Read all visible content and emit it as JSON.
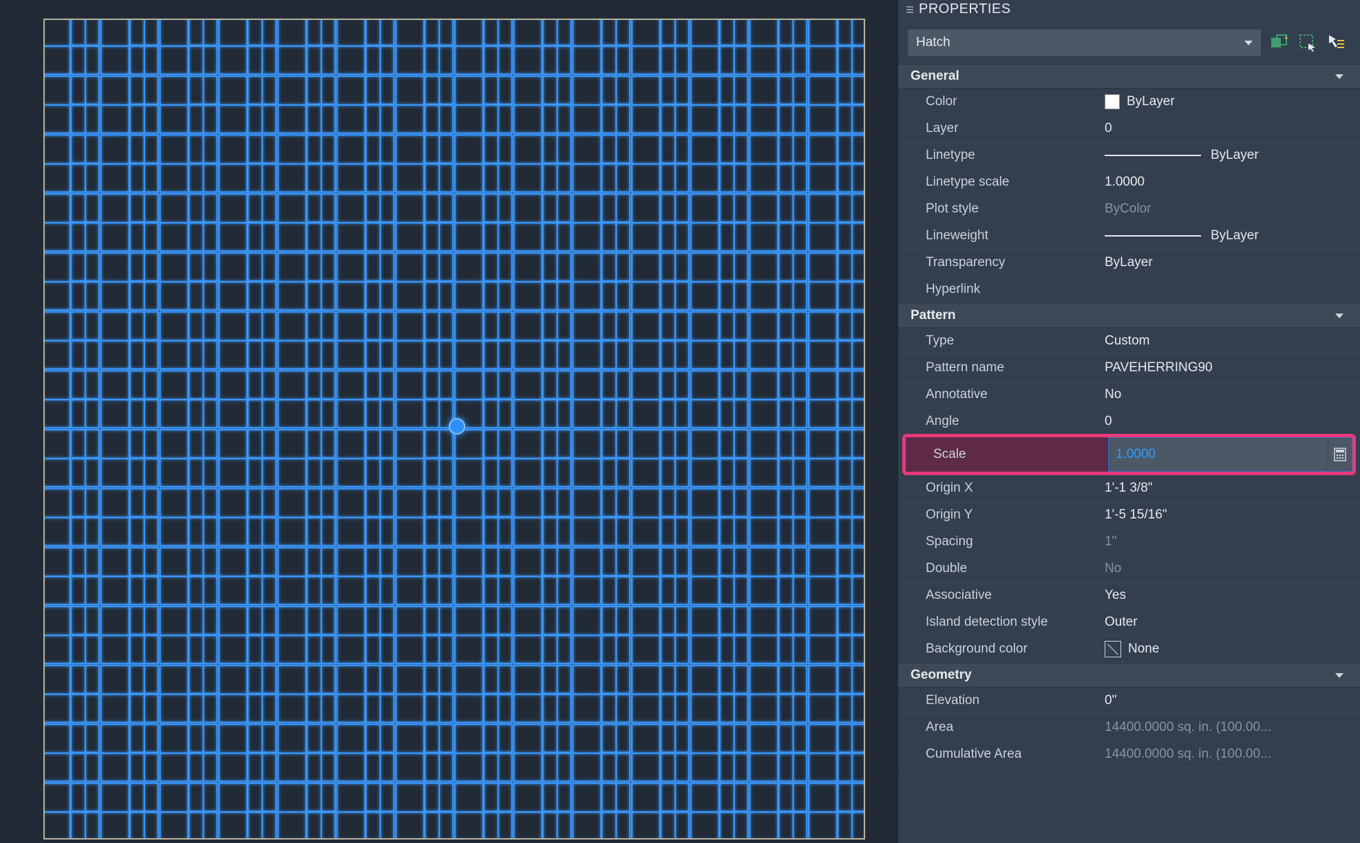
{
  "panel": {
    "title": "PROPERTIES",
    "objectType": "Hatch"
  },
  "icons": {
    "toggle_pickadd": "toggle-pickadd-icon",
    "select_objects": "select-objects-icon",
    "quick_select": "quick-select-icon"
  },
  "sections": {
    "general": {
      "title": "General",
      "rows": {
        "color": {
          "label": "Color",
          "value": "ByLayer"
        },
        "layer": {
          "label": "Layer",
          "value": "0"
        },
        "linetype": {
          "label": "Linetype",
          "value": "ByLayer"
        },
        "linetype_scale": {
          "label": "Linetype scale",
          "value": "1.0000"
        },
        "plot_style": {
          "label": "Plot style",
          "value": "ByColor"
        },
        "lineweight": {
          "label": "Lineweight",
          "value": "ByLayer"
        },
        "transparency": {
          "label": "Transparency",
          "value": "ByLayer"
        },
        "hyperlink": {
          "label": "Hyperlink",
          "value": ""
        }
      }
    },
    "pattern": {
      "title": "Pattern",
      "rows": {
        "type": {
          "label": "Type",
          "value": "Custom"
        },
        "pattern_name": {
          "label": "Pattern name",
          "value": "PAVEHERRING90"
        },
        "annotative": {
          "label": "Annotative",
          "value": "No"
        },
        "angle": {
          "label": "Angle",
          "value": "0"
        },
        "scale": {
          "label": "Scale",
          "value": "1.0000"
        },
        "origin_x": {
          "label": "Origin X",
          "value": "1'-1 3/8\""
        },
        "origin_y": {
          "label": "Origin Y",
          "value": "1'-5 15/16\""
        },
        "spacing": {
          "label": "Spacing",
          "value": "1\""
        },
        "double": {
          "label": "Double",
          "value": "No"
        },
        "associative": {
          "label": "Associative",
          "value": "Yes"
        },
        "island": {
          "label": "Island detection style",
          "value": "Outer"
        },
        "bgcolor": {
          "label": "Background color",
          "value": "None"
        }
      }
    },
    "geometry": {
      "title": "Geometry",
      "rows": {
        "elevation": {
          "label": "Elevation",
          "value": "0\""
        },
        "area": {
          "label": "Area",
          "value": "14400.0000 sq. in. (100.00..."
        },
        "cum_area": {
          "label": "Cumulative Area",
          "value": "14400.0000 sq. in. (100.00..."
        }
      }
    }
  }
}
